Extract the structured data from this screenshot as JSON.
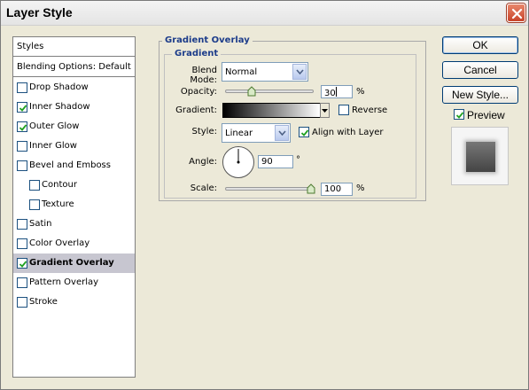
{
  "window": {
    "title": "Layer Style"
  },
  "left_panel": {
    "header": "Styles",
    "blending_options": "Blending Options: Default",
    "items": [
      {
        "label": "Drop Shadow",
        "checked": false,
        "indent": false,
        "selected": false
      },
      {
        "label": "Inner Shadow",
        "checked": true,
        "indent": false,
        "selected": false
      },
      {
        "label": "Outer Glow",
        "checked": true,
        "indent": false,
        "selected": false
      },
      {
        "label": "Inner Glow",
        "checked": false,
        "indent": false,
        "selected": false
      },
      {
        "label": "Bevel and Emboss",
        "checked": false,
        "indent": false,
        "selected": false
      },
      {
        "label": "Contour",
        "checked": false,
        "indent": true,
        "selected": false
      },
      {
        "label": "Texture",
        "checked": false,
        "indent": true,
        "selected": false
      },
      {
        "label": "Satin",
        "checked": false,
        "indent": false,
        "selected": false
      },
      {
        "label": "Color Overlay",
        "checked": false,
        "indent": false,
        "selected": false
      },
      {
        "label": "Gradient Overlay",
        "checked": true,
        "indent": false,
        "selected": true
      },
      {
        "label": "Pattern Overlay",
        "checked": false,
        "indent": false,
        "selected": false
      },
      {
        "label": "Stroke",
        "checked": false,
        "indent": false,
        "selected": false
      }
    ]
  },
  "panel": {
    "group_title": "Gradient Overlay",
    "subgroup_title": "Gradient",
    "blend_mode_label": "Blend Mode:",
    "blend_mode_value": "Normal",
    "opacity_label": "Opacity:",
    "opacity_value": "30",
    "opacity_unit": "%",
    "opacity_fraction": 0.3,
    "gradient_label": "Gradient:",
    "reverse_label": "Reverse",
    "reverse_checked": false,
    "style_label": "Style:",
    "style_value": "Linear",
    "align_label": "Align with Layer",
    "align_checked": true,
    "angle_label": "Angle:",
    "angle_value": "90",
    "angle_unit": "°",
    "scale_label": "Scale:",
    "scale_value": "100",
    "scale_unit": "%",
    "scale_fraction": 0.4
  },
  "buttons": {
    "ok": "OK",
    "cancel": "Cancel",
    "new_style": "New Style...",
    "preview_label": "Preview",
    "preview_checked": true
  },
  "colors": {
    "legend_text": "#1c3c8a",
    "selected_row": "#c7c6d0",
    "close_button": "#c8432a"
  }
}
